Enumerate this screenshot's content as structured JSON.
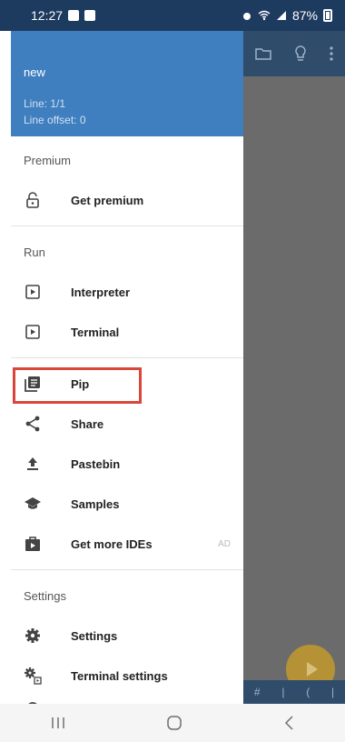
{
  "status": {
    "time": "12:27",
    "battery": "87%"
  },
  "drawer": {
    "header": {
      "title": "new",
      "line": "Line: 1/1",
      "line_offset": "Line offset: 0"
    },
    "sections": {
      "premium": "Premium",
      "run": "Run",
      "settings": "Settings"
    },
    "items": {
      "get_premium": "Get premium",
      "interpreter": "Interpreter",
      "terminal": "Terminal",
      "pip": "Pip",
      "share": "Share",
      "pastebin": "Pastebin",
      "samples": "Samples",
      "get_more_ides": "Get more IDEs",
      "ad_badge": "AD",
      "settings": "Settings",
      "terminal_settings": "Terminal settings"
    }
  },
  "app": {
    "bottom_symbols": [
      "#",
      "|",
      "(",
      "|"
    ]
  },
  "icons": {
    "status_left": [
      "notification-icon",
      "image-icon"
    ],
    "toolbar": [
      "folder-icon",
      "lightbulb-icon",
      "more-vert-icon"
    ],
    "nav": [
      "recent-apps-icon",
      "home-icon",
      "back-icon"
    ]
  },
  "colors": {
    "header": "#3f7fbf",
    "highlight": "#d9463a",
    "fab": "#b59236"
  }
}
